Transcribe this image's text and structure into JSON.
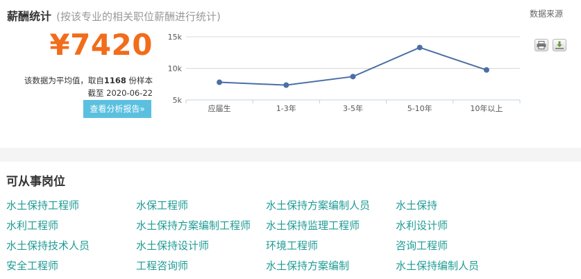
{
  "header": {
    "title": "薪酬统计",
    "subtitle": "(按该专业的相关职位薪酬进行统计)",
    "source_label": "数据来源"
  },
  "salary": {
    "amount": "¥7420",
    "note_prefix": "该数据为平均值，取自",
    "sample_count": "1168",
    "note_suffix": " 份样本",
    "date_note": "截至 2020-06-22",
    "report_button": "查看分析报告»"
  },
  "chart_data": {
    "type": "line",
    "categories": [
      "应届生",
      "1-3年",
      "3-5年",
      "5-10年",
      "10年以上"
    ],
    "series": [
      {
        "values": [
          7800,
          7350,
          8700,
          13300,
          9750
        ]
      }
    ],
    "y_ticks": [
      "15k",
      "10k",
      "5k"
    ],
    "ylim": [
      5000,
      15000
    ],
    "line_color": "#4a6fa5",
    "grid": true
  },
  "jobs": {
    "title": "可从事岗位",
    "items": [
      "水土保持工程师",
      "水保工程师",
      "水土保持方案编制人员",
      "水土保持",
      "水利工程师",
      "水土保持方案编制工程师",
      "水土保持监理工程师",
      "水利设计师",
      "水土保持技术人员",
      "水土保持设计师",
      "环境工程师",
      "咨询工程师",
      "安全工程师",
      "工程咨询师",
      "水土保持方案编制",
      "水土保持编制人员"
    ]
  },
  "icons": {
    "print": "print-icon",
    "download": "download-icon"
  },
  "colors": {
    "accent": "#f26c1a",
    "button": "#5bc0e0",
    "link": "#1e9b94"
  }
}
